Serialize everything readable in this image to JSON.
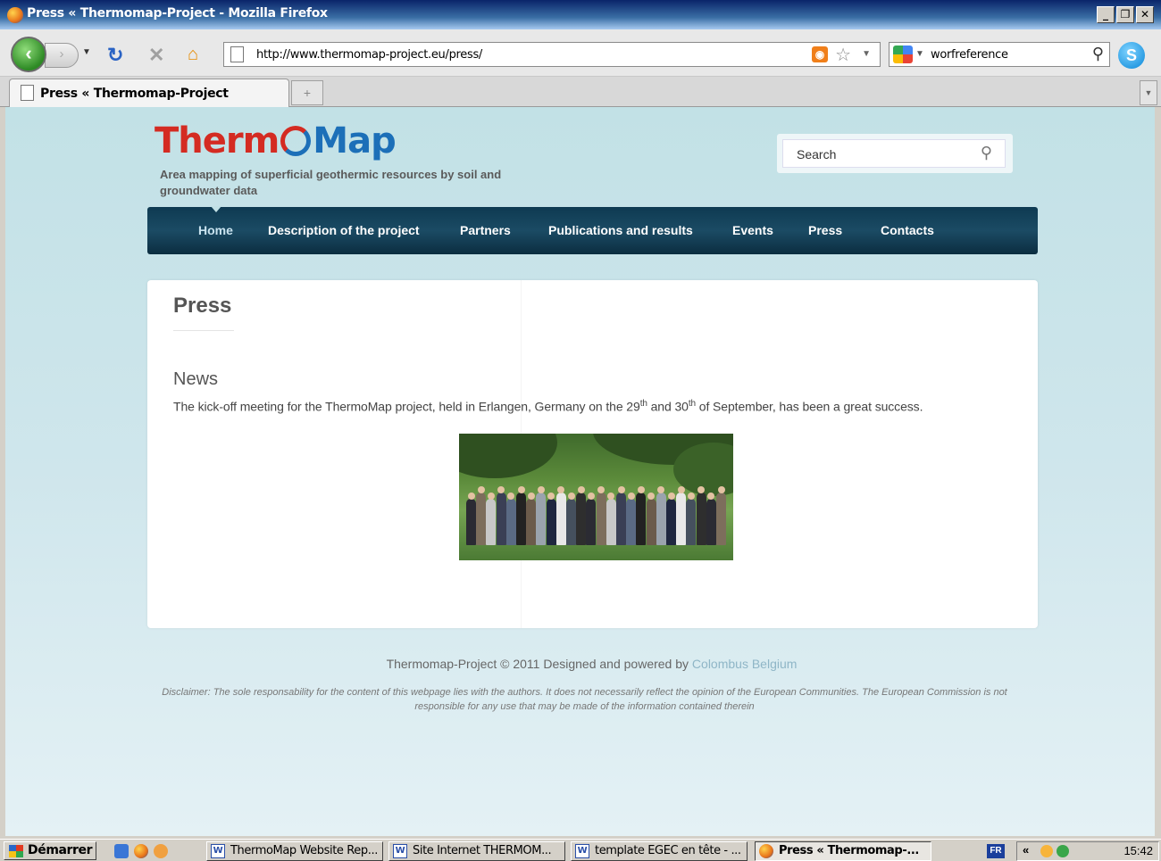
{
  "window": {
    "title": "Press « Thermomap-Project - Mozilla Firefox",
    "controls": [
      "_",
      "❐",
      "✕"
    ]
  },
  "toolbar": {
    "url": "http://www.thermomap-project.eu/press/",
    "search_value": "worfreference"
  },
  "tabs": [
    {
      "label": "Press « Thermomap-Project",
      "active": true
    }
  ],
  "site": {
    "logo_part1": "Therm",
    "logo_part2": "Map",
    "tagline": "Area mapping of superficial geothermic resources by soil and groundwater data",
    "search_placeholder": "Search",
    "menu": [
      {
        "label": "Home",
        "active": true
      },
      {
        "label": "Description of the project"
      },
      {
        "label": "Partners"
      },
      {
        "label": "Publications and results"
      },
      {
        "label": "Events"
      },
      {
        "label": "Press"
      },
      {
        "label": "Contacts"
      }
    ],
    "page_title": "Press",
    "news_heading": "News",
    "news_text_1": "The kick-off meeting for the ThermoMap project, held in Erlangen, Germany on the 29",
    "news_sup_1": "th",
    "news_text_2": " and 30",
    "news_sup_2": "th",
    "news_text_3": " of September, has been a great success.",
    "footer_credit": "Thermomap-Project © 2011 Designed and powered by ",
    "footer_link": "Colombus Belgium",
    "disclaimer": "Disclaimer: The sole responsability for the content of this webpage lies with the authors. It does not necessarily reflect the opinion of the European Communities. The European Commission is not responsible for any use that may be made of the information contained therein"
  },
  "taskbar": {
    "start_label": "Démarrer",
    "items": [
      {
        "label": "ThermoMap Website Rep...",
        "icon": "word-icon"
      },
      {
        "label": "Site Internet THERMOM...",
        "icon": "word-icon"
      },
      {
        "label": "template EGEC en tête - ...",
        "icon": "word-icon"
      },
      {
        "label": "Press « Thermomap-...",
        "icon": "firefox-icon",
        "active": true
      }
    ],
    "language": "FR",
    "clock": "15:42"
  }
}
